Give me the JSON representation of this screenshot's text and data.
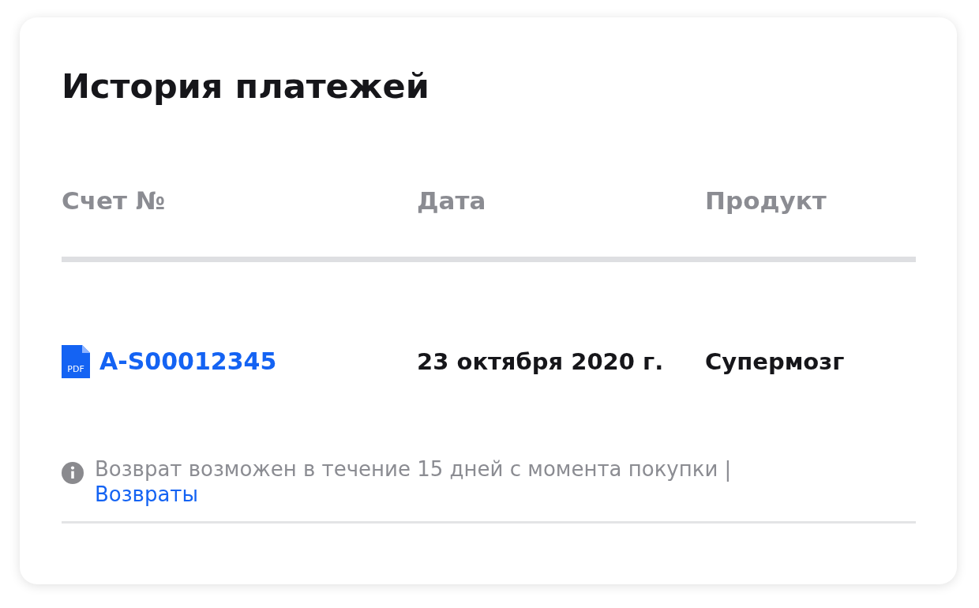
{
  "title": "История платежей",
  "table": {
    "columns": [
      "Счет №",
      "Дата",
      "Продукт"
    ],
    "rows": [
      {
        "file_icon_label": "PDF",
        "invoice": "A-S00012345",
        "date": "23 октября 2020 г.",
        "product": "Супермозг"
      }
    ]
  },
  "note": {
    "text": "Возврат возможен в течение 15 дней с момента покупки |",
    "link": "Возвраты"
  }
}
